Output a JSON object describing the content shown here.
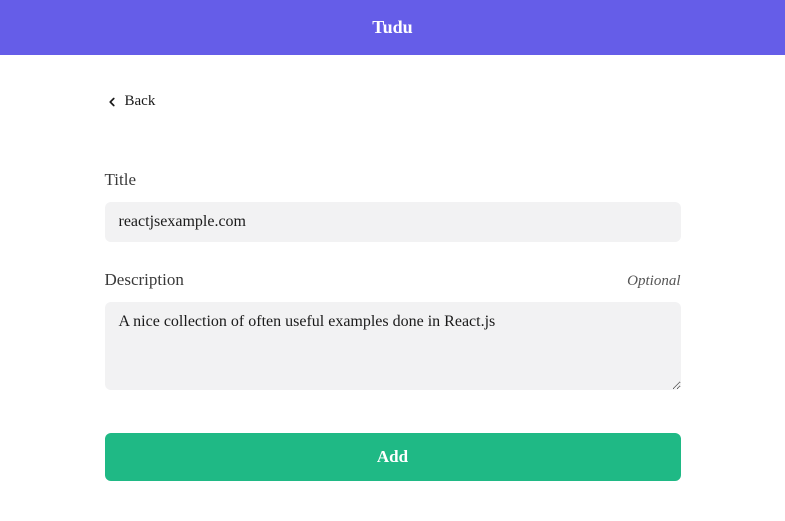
{
  "header": {
    "title": "Tudu"
  },
  "back": {
    "label": "Back"
  },
  "form": {
    "title_label": "Title",
    "title_value": "reactjsexample.com",
    "description_label": "Description",
    "description_optional": "Optional",
    "description_value": "A nice collection of often useful examples done in React.js",
    "submit_label": "Add"
  },
  "colors": {
    "header_bg": "#655de8",
    "button_bg": "#1fb985",
    "input_bg": "#f2f2f3"
  }
}
